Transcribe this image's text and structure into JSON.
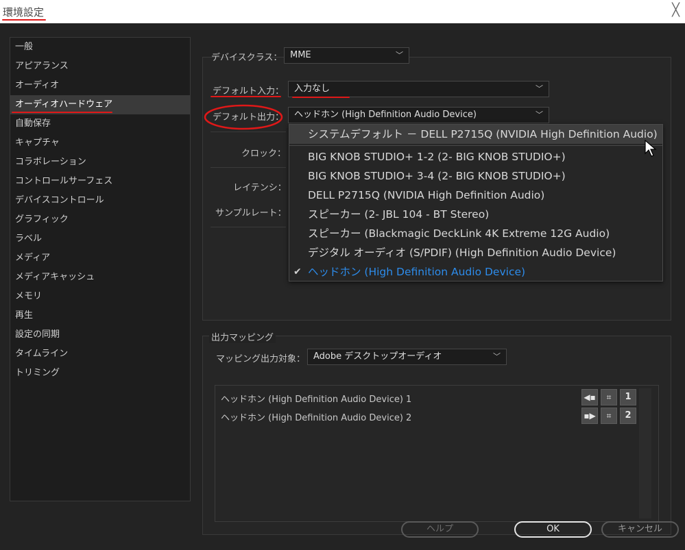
{
  "window": {
    "title": "環境設定",
    "close_glyph": "╳"
  },
  "sidebar": {
    "items": [
      {
        "label": "一般"
      },
      {
        "label": "アピアランス"
      },
      {
        "label": "オーディオ"
      },
      {
        "label": "オーディオハードウェア",
        "selected": true
      },
      {
        "label": "自動保存"
      },
      {
        "label": "キャプチャ"
      },
      {
        "label": "コラボレーション"
      },
      {
        "label": "コントロールサーフェス"
      },
      {
        "label": "デバイスコントロール"
      },
      {
        "label": "グラフィック"
      },
      {
        "label": "ラベル"
      },
      {
        "label": "メディア"
      },
      {
        "label": "メディアキャッシュ"
      },
      {
        "label": "メモリ"
      },
      {
        "label": "再生"
      },
      {
        "label": "設定の同期"
      },
      {
        "label": "タイムライン"
      },
      {
        "label": "トリミング"
      }
    ]
  },
  "device": {
    "class_label": "デバイスクラス：",
    "class_value": "MME",
    "input_label": "デフォルト入力：",
    "input_value": "入力なし",
    "output_label": "デフォルト出力：",
    "output_value": "ヘッドホン (High Definition Audio Device)",
    "clock_label": "クロック：",
    "latency_label": "レイテンシ：",
    "samplerate_label": "サンプルレート："
  },
  "output_menu": {
    "options": [
      {
        "label": "システムデフォルト － DELL P2715Q (NVIDIA High Definition Audio)",
        "hover": true
      },
      {
        "label": "BIG KNOB STUDIO+ 1-2 (2- BIG KNOB STUDIO+)"
      },
      {
        "label": "BIG KNOB STUDIO+ 3-4 (2- BIG KNOB STUDIO+)"
      },
      {
        "label": "DELL P2715Q (NVIDIA High Definition Audio)"
      },
      {
        "label": "スピーカー (2- JBL 104 - BT Stereo)"
      },
      {
        "label": "スピーカー (Blackmagic DeckLink 4K Extreme 12G Audio)"
      },
      {
        "label": "デジタル オーディオ (S/PDIF) (High Definition Audio Device)"
      },
      {
        "label": "ヘッドホン (High Definition Audio Device)",
        "checked": true
      }
    ],
    "check_glyph": "✔"
  },
  "mapping": {
    "section_title": "出力マッピング",
    "target_label": "マッピング出力対象：",
    "target_value": "Adobe デスクトップオーディオ",
    "rows": [
      {
        "label": "ヘッドホン (High Definition Audio Device) 1",
        "channel": "1"
      },
      {
        "label": "ヘッドホン (High Definition Audio Device) 2",
        "channel": "2"
      }
    ]
  },
  "buttons": {
    "help": "ヘルプ",
    "ok": "OK",
    "cancel": "キャンセル"
  },
  "colors": {
    "annotation": "#e01818",
    "checked_item": "#2d8ceb"
  }
}
